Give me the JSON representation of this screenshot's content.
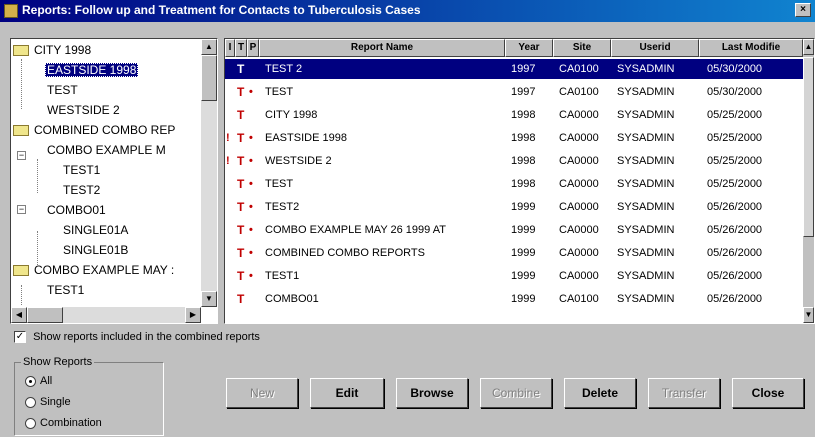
{
  "window": {
    "title": "Reports: Follow up and Treatment for Contacts to Tuberculosis Cases",
    "close_glyph": "×"
  },
  "tree": {
    "items": [
      {
        "label": "CITY 1998",
        "icon": "folder-icon",
        "selected": false
      },
      {
        "label": "EASTSIDE 1998",
        "icon": "",
        "selected": true
      },
      {
        "label": "TEST",
        "icon": "",
        "selected": false
      },
      {
        "label": "WESTSIDE 2",
        "icon": "",
        "selected": false
      },
      {
        "label": "COMBINED COMBO REP",
        "icon": "folder-icon",
        "selected": false
      },
      {
        "label": "COMBO EXAMPLE M",
        "icon": "",
        "selected": false
      },
      {
        "label": "TEST1",
        "icon": "",
        "selected": false
      },
      {
        "label": "TEST2",
        "icon": "",
        "selected": false
      },
      {
        "label": "COMBO01",
        "icon": "",
        "selected": false
      },
      {
        "label": "SINGLE01A",
        "icon": "",
        "selected": false
      },
      {
        "label": "SINGLE01B",
        "icon": "",
        "selected": false
      },
      {
        "label": "COMBO EXAMPLE MAY :",
        "icon": "folder-icon",
        "selected": false
      },
      {
        "label": "TEST1",
        "icon": "",
        "selected": false
      }
    ]
  },
  "grid": {
    "columns": [
      "I",
      "T",
      "P",
      "Report Name",
      "Year",
      "Site",
      "Userid",
      "Last Modifie"
    ],
    "rows": [
      {
        "i": "",
        "t": "T",
        "p": "",
        "name": "TEST 2",
        "year": "1997",
        "site": "CA0100",
        "userid": "SYSADMIN",
        "modified": "05/30/2000",
        "selected": true
      },
      {
        "i": "",
        "t": "T",
        "p": "•",
        "name": "TEST",
        "year": "1997",
        "site": "CA0100",
        "userid": "SYSADMIN",
        "modified": "05/30/2000",
        "selected": false
      },
      {
        "i": "",
        "t": "T",
        "p": "",
        "name": "CITY 1998",
        "year": "1998",
        "site": "CA0000",
        "userid": "SYSADMIN",
        "modified": "05/25/2000",
        "selected": false
      },
      {
        "i": "!",
        "t": "T",
        "p": "•",
        "name": "EASTSIDE 1998",
        "year": "1998",
        "site": "CA0000",
        "userid": "SYSADMIN",
        "modified": "05/25/2000",
        "selected": false
      },
      {
        "i": "!",
        "t": "T",
        "p": "•",
        "name": "WESTSIDE 2",
        "year": "1998",
        "site": "CA0000",
        "userid": "SYSADMIN",
        "modified": "05/25/2000",
        "selected": false
      },
      {
        "i": "",
        "t": "T",
        "p": "•",
        "name": "TEST",
        "year": "1998",
        "site": "CA0000",
        "userid": "SYSADMIN",
        "modified": "05/25/2000",
        "selected": false
      },
      {
        "i": "",
        "t": "T",
        "p": "•",
        "name": "TEST2",
        "year": "1999",
        "site": "CA0000",
        "userid": "SYSADMIN",
        "modified": "05/26/2000",
        "selected": false
      },
      {
        "i": "",
        "t": "T",
        "p": "•",
        "name": "COMBO EXAMPLE MAY 26 1999 AT",
        "year": "1999",
        "site": "CA0000",
        "userid": "SYSADMIN",
        "modified": "05/26/2000",
        "selected": false
      },
      {
        "i": "",
        "t": "T",
        "p": "•",
        "name": "COMBINED COMBO REPORTS",
        "year": "1999",
        "site": "CA0000",
        "userid": "SYSADMIN",
        "modified": "05/26/2000",
        "selected": false
      },
      {
        "i": "",
        "t": "T",
        "p": "•",
        "name": "TEST1",
        "year": "1999",
        "site": "CA0000",
        "userid": "SYSADMIN",
        "modified": "05/26/2000",
        "selected": false
      },
      {
        "i": "",
        "t": "T",
        "p": "",
        "name": "COMBO01",
        "year": "1999",
        "site": "CA0100",
        "userid": "SYSADMIN",
        "modified": "05/26/2000",
        "selected": false
      }
    ]
  },
  "options": {
    "show_combined_label": "Show reports included in the combined reports",
    "show_combined_checked": true,
    "check_glyph": "✓",
    "group_title": "Show Reports",
    "radios": [
      {
        "label": "All",
        "checked": true
      },
      {
        "label": "Single",
        "checked": false
      },
      {
        "label": "Combination",
        "checked": false
      }
    ]
  },
  "buttons": [
    {
      "label": "New",
      "enabled": false
    },
    {
      "label": "Edit",
      "enabled": true
    },
    {
      "label": "Browse",
      "enabled": true
    },
    {
      "label": "Combine",
      "enabled": false
    },
    {
      "label": "Delete",
      "enabled": true
    },
    {
      "label": "Transfer",
      "enabled": false
    },
    {
      "label": "Close",
      "enabled": true
    }
  ],
  "scroll_glyphs": {
    "up": "▲",
    "down": "▼",
    "left": "◀",
    "right": "▶"
  }
}
